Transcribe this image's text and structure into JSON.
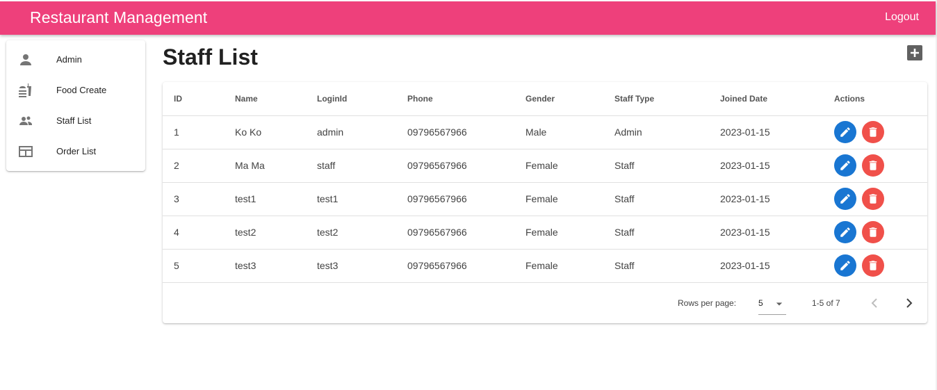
{
  "header": {
    "title": "Restaurant Management",
    "logout_label": "Logout",
    "bar_color": "#ee407b"
  },
  "sidebar": {
    "items": [
      {
        "label": "Admin",
        "icon": "person-icon"
      },
      {
        "label": "Food Create",
        "icon": "fastfood-icon"
      },
      {
        "label": "Staff List",
        "icon": "people-icon"
      },
      {
        "label": "Order List",
        "icon": "table-icon"
      }
    ]
  },
  "main": {
    "title": "Staff List",
    "add_icon": "add-box-icon",
    "table": {
      "columns": [
        "ID",
        "Name",
        "LoginId",
        "Phone",
        "Gender",
        "Staff Type",
        "Joined Date",
        "Actions"
      ],
      "rows": [
        {
          "id": "1",
          "name": "Ko Ko",
          "login": "admin",
          "phone": "09796567966",
          "gender": "Male",
          "type": "Admin",
          "joined": "2023-01-15"
        },
        {
          "id": "2",
          "name": "Ma Ma",
          "login": "staff",
          "phone": "09796567966",
          "gender": "Female",
          "type": "Staff",
          "joined": "2023-01-15"
        },
        {
          "id": "3",
          "name": "test1",
          "login": "test1",
          "phone": "09796567966",
          "gender": "Female",
          "type": "Staff",
          "joined": "2023-01-15"
        },
        {
          "id": "4",
          "name": "test2",
          "login": "test2",
          "phone": "09796567966",
          "gender": "Female",
          "type": "Staff",
          "joined": "2023-01-15"
        },
        {
          "id": "5",
          "name": "test3",
          "login": "test3",
          "phone": "09796567966",
          "gender": "Female",
          "type": "Staff",
          "joined": "2023-01-15"
        }
      ]
    },
    "pagination": {
      "rows_label": "Rows per page:",
      "rows_value": "5",
      "range": "1-5 of 7"
    },
    "colors": {
      "edit": "#1976d2",
      "delete": "#f0504a"
    }
  }
}
